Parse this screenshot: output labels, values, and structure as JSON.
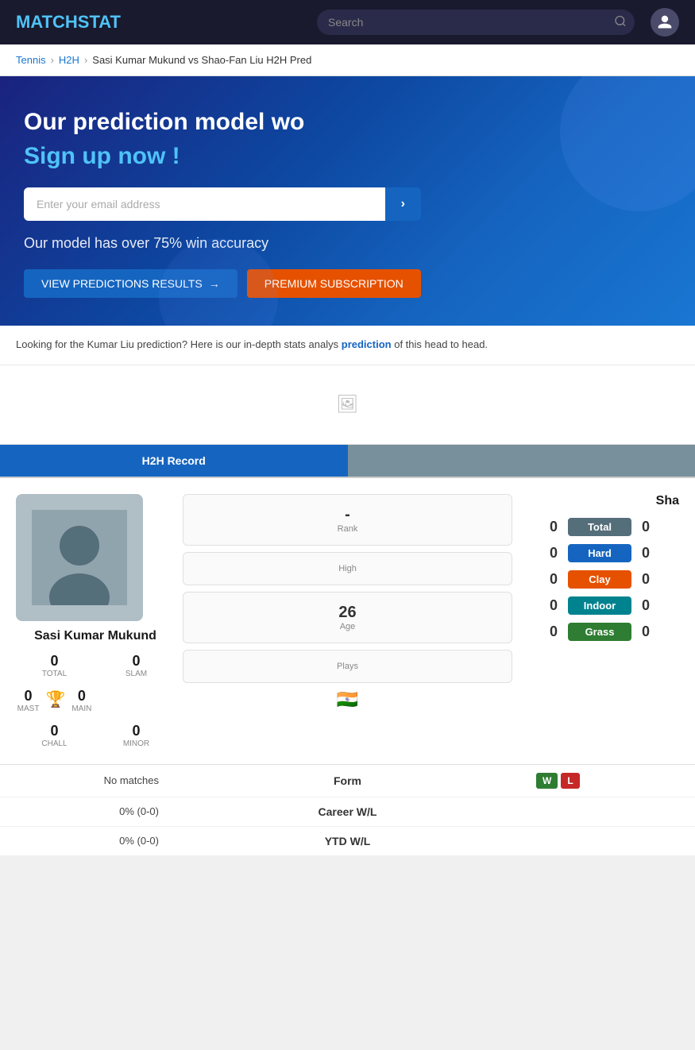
{
  "header": {
    "logo_match": "MATCH",
    "logo_stat": "STAT",
    "search_placeholder": "Search",
    "user_icon": "👤"
  },
  "breadcrumb": {
    "tennis": "Tennis",
    "h2h": "H2H",
    "current": "Sasi Kumar Mukund vs Shao-Fan Liu H2H Pred"
  },
  "banner": {
    "title": "Our prediction model wo",
    "subtitle": "Sign up now !",
    "email_placeholder": "Enter your email address",
    "accuracy": "Our model has over 75% win accuracy",
    "btn_view": "VIEW PREDICTIONS RESULTS",
    "btn_arrow": "→",
    "btn_premium": "PREMIUM SUBSCRIPTION"
  },
  "description": {
    "text1": "Looking for the Kumar Liu prediction? Here is our in-depth stats analys",
    "link_text": "prediction",
    "text2": "of this head to head."
  },
  "tabs": {
    "h2h_record": "H2H Record",
    "second_tab": ""
  },
  "player_left": {
    "name": "Sasi Kumar Mukund",
    "total": "0",
    "total_label": "Total",
    "slam": "0",
    "slam_label": "Slam",
    "mast": "0",
    "mast_label": "Mast",
    "main": "0",
    "main_label": "Main",
    "chall": "0",
    "chall_label": "Chall",
    "minor": "0",
    "minor_label": "Minor"
  },
  "player_right": {
    "name": "Sha"
  },
  "center_stats": {
    "rank_val": "-",
    "rank_label": "Rank",
    "rank_high_val": "High",
    "rank_high_label": "",
    "age_val": "26",
    "age_label": "Age",
    "plays_label": "Plays"
  },
  "scores": {
    "total_left": "0",
    "total_badge": "Total",
    "total_right": "0",
    "hard_left": "0",
    "hard_badge": "Hard",
    "hard_right": "0",
    "clay_left": "0",
    "clay_badge": "Clay",
    "clay_right": "0",
    "indoor_left": "0",
    "indoor_badge": "Indoor",
    "indoor_right": "0",
    "grass_left": "0",
    "grass_badge": "Grass",
    "grass_right": "0"
  },
  "form_row": {
    "left_val": "No matches",
    "label": "Form",
    "right_w": "W",
    "right_l": "L"
  },
  "career_wl": {
    "left_val": "0% (0-0)",
    "label": "Career W/L",
    "right_val": ""
  },
  "ytd_wl": {
    "left_val": "0% (0-0)",
    "label": "YTD W/L",
    "right_val": ""
  }
}
